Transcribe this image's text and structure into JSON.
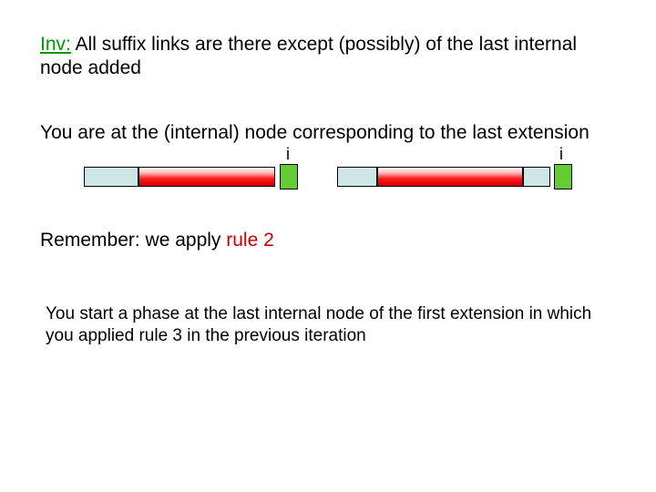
{
  "inv_label": "Inv:",
  "inv_text": " All suffix links are there except (possibly) of the last internal node added",
  "node_text": "You are at the (internal) node corresponding to the last extension",
  "i_label_left": "i",
  "i_label_right": "i",
  "remember_text_pre": "Remember: we apply ",
  "remember_rule": "rule 2",
  "phase_text": "You start a phase at the last internal node of the first extension in which you applied rule 3 in the previous iteration"
}
